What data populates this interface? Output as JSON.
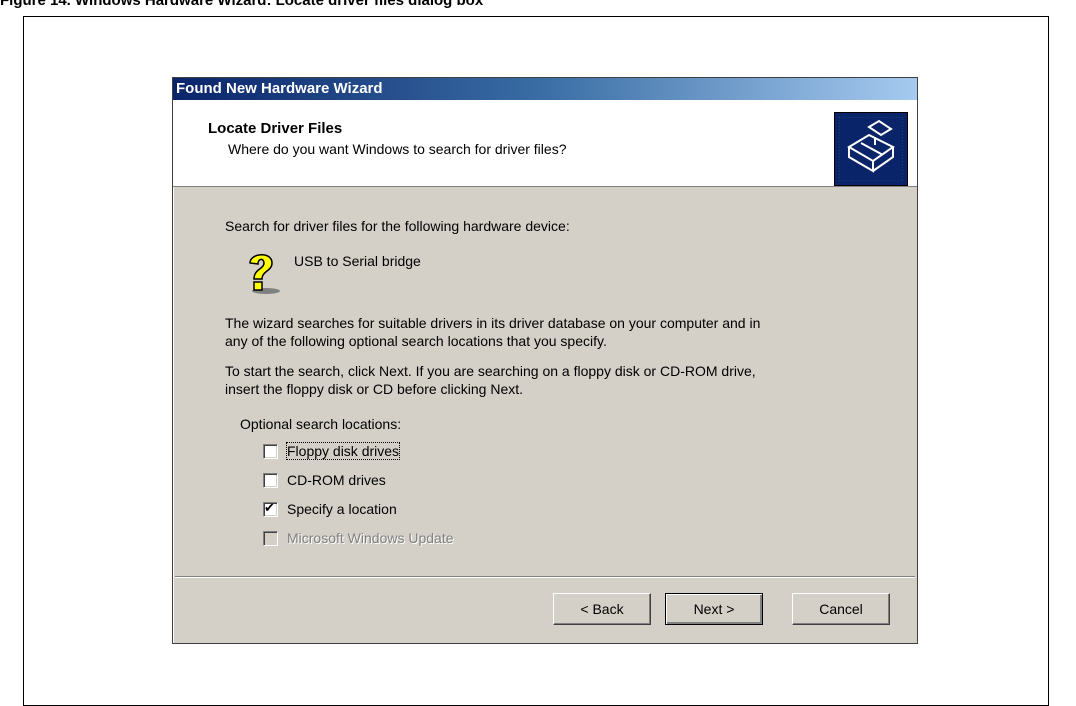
{
  "caption": "Figure 14. Windows Hardware Wizard: Locate driver files dialog box",
  "dialog": {
    "title": "Found New Hardware Wizard",
    "header": {
      "heading": "Locate Driver Files",
      "subheading": "Where do you want Windows to search for driver files?",
      "icon": "hardware-wizard-icon"
    },
    "device_prompt": "Search for driver files for the following hardware device:",
    "device_icon": "unknown-device-question-icon",
    "device_name": "USB to Serial bridge",
    "description_1a": "The wizard searches for suitable drivers in its driver database on your computer and in",
    "description_1b": "any of the following optional search locations that you specify.",
    "description_2a": "To start the search, click Next. If you are searching on a floppy disk or CD-ROM drive,",
    "description_2b": "insert the floppy disk or CD before clicking Next.",
    "locations_heading": "Optional search locations:",
    "options": [
      {
        "label": "Floppy disk drives",
        "checked": false,
        "enabled": true
      },
      {
        "label": "CD-ROM drives",
        "checked": false,
        "enabled": true
      },
      {
        "label": "Specify a location",
        "checked": true,
        "enabled": true
      },
      {
        "label": "Microsoft Windows Update",
        "checked": false,
        "enabled": false
      }
    ],
    "buttons": {
      "back": "< Back",
      "next": "Next >",
      "cancel": "Cancel"
    }
  },
  "colors": {
    "titlebar_start": "#0a246a",
    "titlebar_end": "#a6caf0",
    "dialog_face": "#d4d0c8"
  }
}
